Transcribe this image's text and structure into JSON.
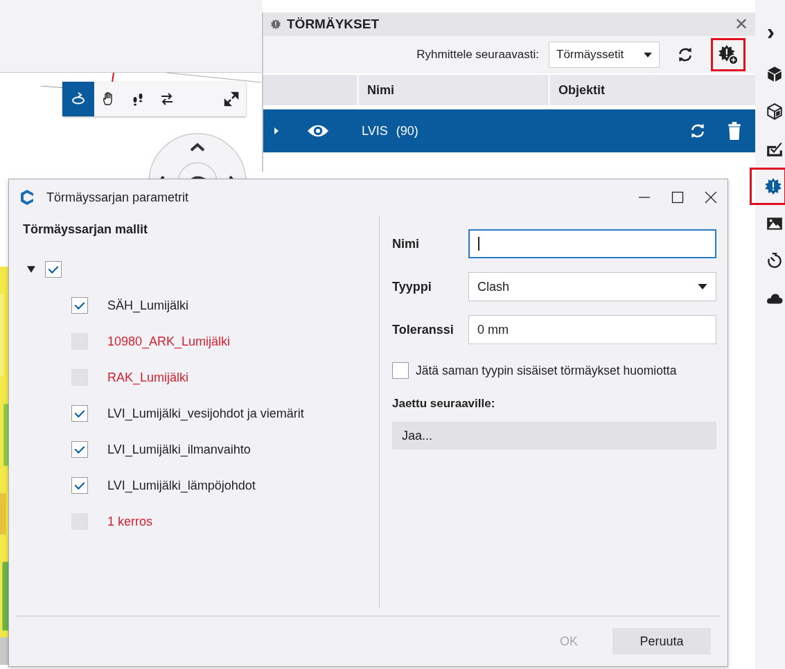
{
  "navigation_toolbar": {
    "tools": [
      {
        "selected": true
      },
      {
        "selected": false
      },
      {
        "selected": false
      },
      {
        "selected": false
      },
      {
        "selected": false
      }
    ]
  },
  "clash_panel": {
    "title": "TÖRMÄYKSET",
    "close_glyph": "✕",
    "group_by_label": "Ryhmittele seuraavasti:",
    "group_by_value": "Törmäyssetit",
    "add_button_highlighted": true,
    "columns": [
      "Nimi",
      "Objektit"
    ],
    "rows": [
      {
        "name": "LVIS",
        "count": "(90)",
        "selected": true,
        "visible": true,
        "expanded": false
      }
    ]
  },
  "sidebar": {
    "collapse_glyph": "›",
    "items": [
      {
        "selected": false,
        "highlighted": false
      },
      {
        "selected": false,
        "highlighted": false
      },
      {
        "selected": false,
        "highlighted": false
      },
      {
        "selected": true,
        "highlighted": true
      },
      {
        "selected": false,
        "highlighted": false
      },
      {
        "selected": false,
        "highlighted": false
      },
      {
        "selected": false,
        "highlighted": false
      }
    ]
  },
  "dialog": {
    "title": "Törmäyssarjan parametrit",
    "models_heading": "Törmäyssarjan mallit",
    "tree_root": {
      "checked": true,
      "expanded": true,
      "children": [
        {
          "name": "SÄH_Lumijälki",
          "checked": true,
          "missing": false
        },
        {
          "name": "10980_ARK_Lumijälki",
          "checked": false,
          "missing": true
        },
        {
          "name": "RAK_Lumijälki",
          "checked": false,
          "missing": true
        },
        {
          "name": "LVI_Lumijälki_vesijohdot ja viemärit",
          "checked": true,
          "missing": false
        },
        {
          "name": "LVI_Lumijälki_ilmanvaihto",
          "checked": true,
          "missing": false
        },
        {
          "name": "LVI_Lumijälki_lämpöjohdot",
          "checked": true,
          "missing": false
        },
        {
          "name": "1 kerros",
          "checked": false,
          "missing": true
        }
      ]
    },
    "name_label": "Nimi",
    "type_label": "Tyyppi",
    "type_value": "Clash",
    "tolerance_label": "Toleranssi",
    "tolerance_value": "0 mm",
    "ignore_same_type": {
      "label": "Jätä saman tyypin sisäiset törmäykset huomiotta",
      "checked": false
    },
    "shared_label": "Jaettu seuraaville:",
    "share_button": "Jaa...",
    "ok_button": {
      "label": "OK",
      "disabled": true
    },
    "cancel_button": "Peruuta"
  }
}
